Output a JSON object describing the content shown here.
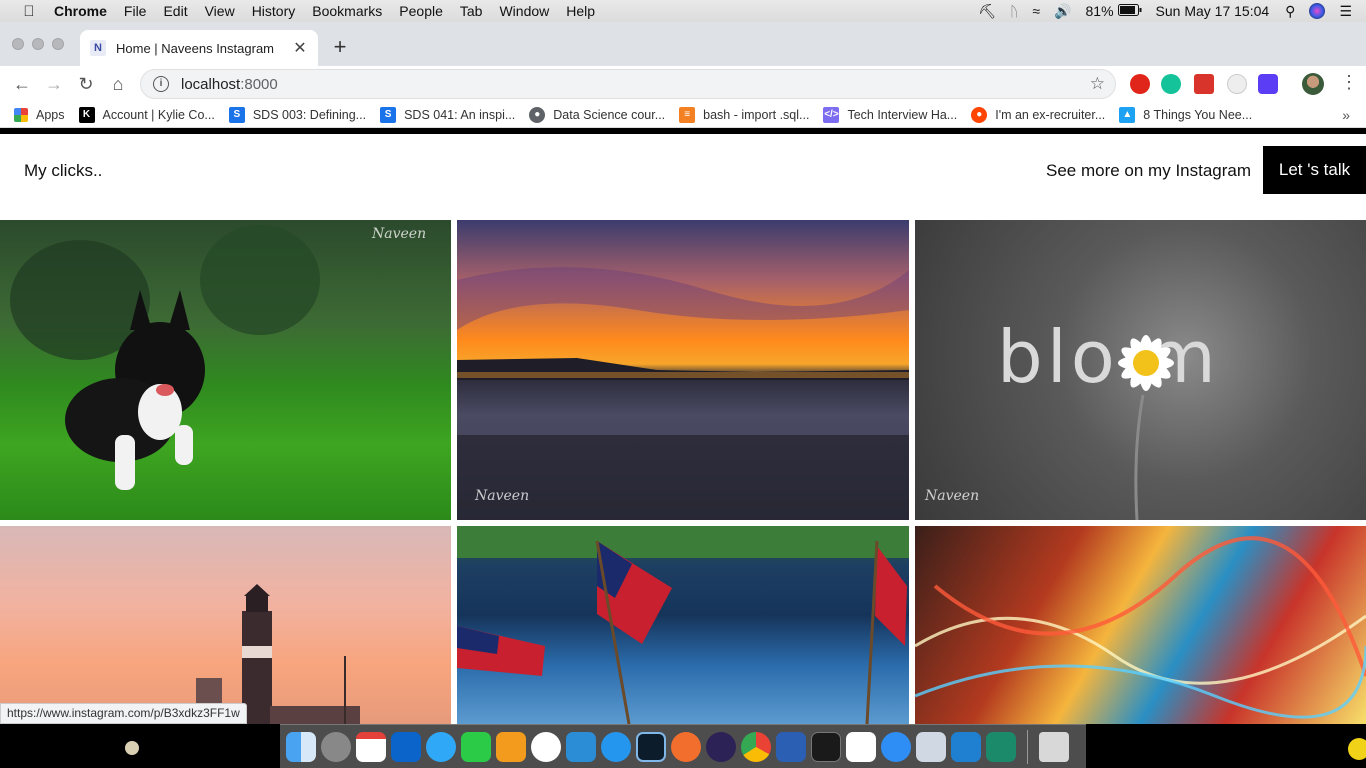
{
  "menubar": {
    "app": "Chrome",
    "items": [
      "File",
      "Edit",
      "View",
      "History",
      "Bookmarks",
      "People",
      "Tab",
      "Window",
      "Help"
    ],
    "battery": "81%",
    "datetime": "Sun May 17  15:04"
  },
  "tab": {
    "favicon": "N",
    "title": "Home | Naveens Instagram"
  },
  "address": {
    "host": "localhost",
    "port": ":8000"
  },
  "bookmarks": [
    {
      "label": "Apps",
      "icon": "apps-grid-icon",
      "color": "#ea4335"
    },
    {
      "label": "Account | Kylie Co...",
      "icon": "k-icon",
      "color": "#000000"
    },
    {
      "label": "SDS 003: Defining...",
      "icon": "sds-icon",
      "color": "#1a73e8"
    },
    {
      "label": "SDS 041: An inspi...",
      "icon": "sds-icon",
      "color": "#1a73e8"
    },
    {
      "label": "Data Science cour...",
      "icon": "globe-icon",
      "color": "#5f6368"
    },
    {
      "label": "bash - import .sql...",
      "icon": "stackoverflow-icon",
      "color": "#f48024"
    },
    {
      "label": "Tech Interview Ha...",
      "icon": "code-icon",
      "color": "#7c6cf0"
    },
    {
      "label": "I'm an ex-recruiter...",
      "icon": "reddit-icon",
      "color": "#ff4500"
    },
    {
      "label": "8 Things You Nee...",
      "icon": "bookmark-icon",
      "color": "#1da1f2"
    }
  ],
  "site": {
    "brand": "My clicks..",
    "nav_link": "See more on my Instagram",
    "cta": "Let 's talk"
  },
  "photos": {
    "bloom_text": "blo  m"
  },
  "status_url": "https://www.instagram.com/p/B3xdkz3FF1w",
  "dock_icons": [
    "finder-icon",
    "launchpad-icon",
    "calendar-icon",
    "outlook-icon",
    "messages-icon",
    "facetime-icon",
    "sublime-icon",
    "mongodb-icon",
    "vscode-icon",
    "docker-icon",
    "lightroom-icon",
    "swift-icon",
    "eclipse-icon",
    "chrome-icon",
    "word-icon",
    "terminal-icon",
    "slack-icon",
    "safari-icon",
    "preview-icon",
    "vscode-icon",
    "vscode-insiders-icon",
    "trash-icon"
  ]
}
